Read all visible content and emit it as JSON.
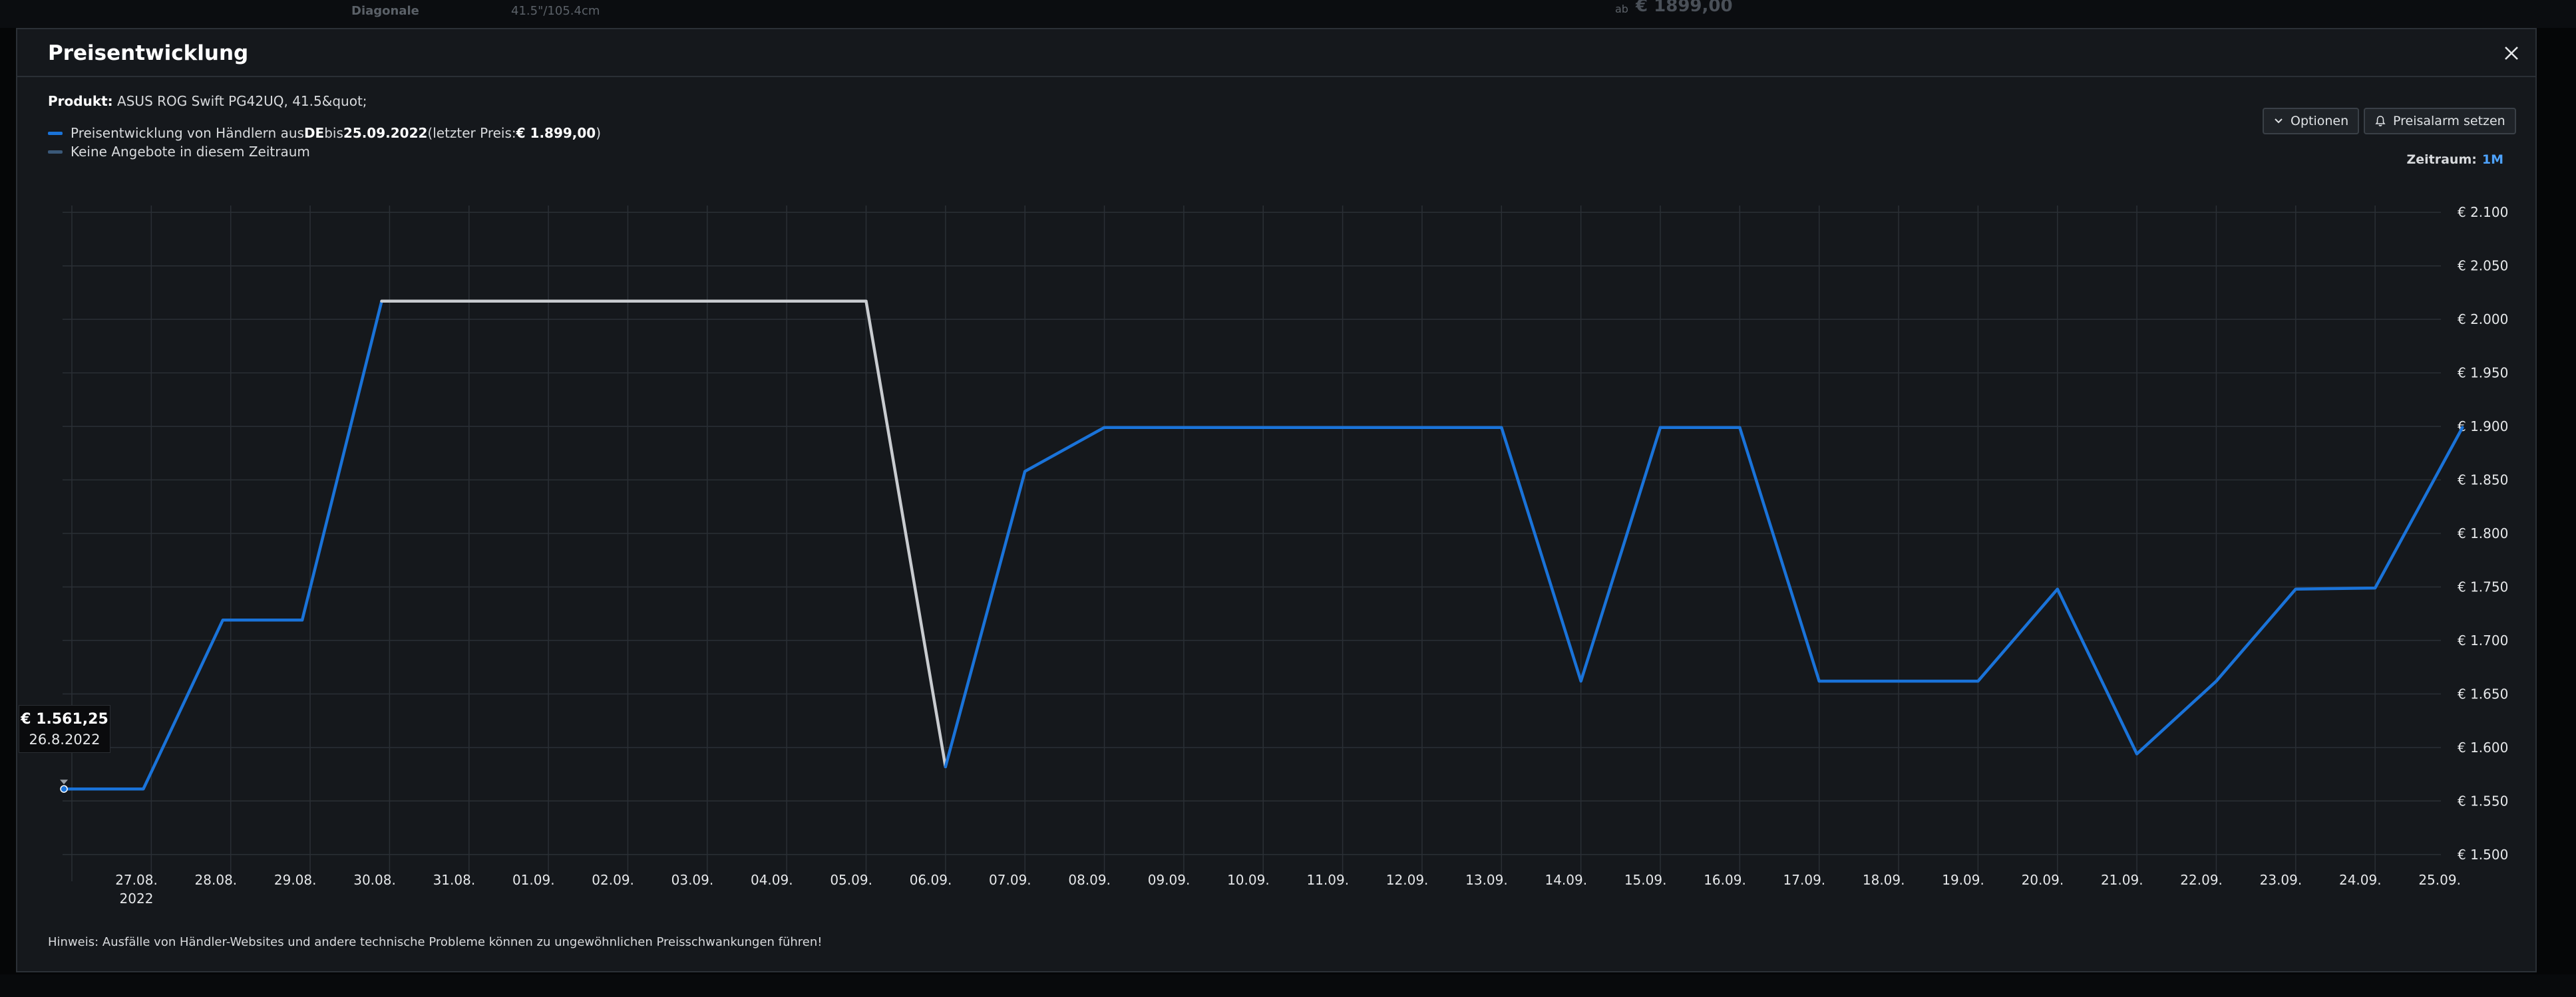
{
  "background": {
    "label": "Diagonale",
    "value": "41.5\"/105.4cm",
    "price": "€ 1899,00",
    "price_prefix": "ab"
  },
  "modal": {
    "title": "Preisentwicklung",
    "close_icon": "close-icon"
  },
  "product": {
    "label": "Produkt:",
    "name": "ASUS ROG Swift PG42UQ, 41.5&quot;"
  },
  "legend": [
    {
      "prefix": "Preisentwicklung von Händlern aus ",
      "country": "DE",
      "mid": " bis ",
      "date": "25.09.2022",
      "suffix_open": " (letzter Preis: ",
      "last_price": "€ 1.899,00",
      "suffix_close": ")",
      "color": "#1a73d9"
    },
    {
      "text": "Keine Angebote in diesem Zeitraum",
      "color": "#3a5878"
    }
  ],
  "buttons": {
    "options_label": "Optionen",
    "options_icon": "chevron-down-icon",
    "alarm_label": "Preisalarm setzen",
    "alarm_icon": "bell-icon"
  },
  "zeitraum": {
    "label": "Zeitraum:",
    "value": "1M"
  },
  "tooltip": {
    "price": "€ 1.561,25",
    "date": "26.8.2022"
  },
  "hint": "Hinweis: Ausfälle von Händler-Websites und andere technische Probleme können zu ungewöhnlichen Preisschwankungen führen!",
  "colors": {
    "price_line": "#1a73d9",
    "no_offer_line": "#c9ccd0",
    "grid": "#2a2f35"
  },
  "chart_data": {
    "type": "line",
    "x_year_label": "2022",
    "x_labels": [
      "27.08.",
      "28.08.",
      "29.08.",
      "30.08.",
      "31.08.",
      "01.09.",
      "02.09.",
      "03.09.",
      "04.09.",
      "05.09.",
      "06.09.",
      "07.09.",
      "08.09.",
      "09.09.",
      "10.09.",
      "11.09.",
      "12.09.",
      "13.09.",
      "14.09.",
      "15.09.",
      "16.09.",
      "17.09.",
      "18.09.",
      "19.09.",
      "20.09.",
      "21.09.",
      "22.09.",
      "23.09.",
      "24.09.",
      "25.09."
    ],
    "y_tick_values": [
      1500,
      1550,
      1600,
      1650,
      1700,
      1750,
      1800,
      1850,
      1900,
      1950,
      2000,
      2050,
      2100
    ],
    "y_tick_labels": [
      "€ 1.500",
      "€ 1.550",
      "€ 1.600",
      "€ 1.650",
      "€ 1.700",
      "€ 1.750",
      "€ 1.800",
      "€ 1.850",
      "€ 1.900",
      "€ 1.950",
      "€ 2.000",
      "€ 2.050",
      "€ 2.100"
    ],
    "ylim": [
      1475,
      2125
    ],
    "x_range_days": [
      -0.1,
      30.1
    ],
    "grid": true,
    "series": [
      {
        "style": "price",
        "points": [
          [
            -0.1,
            1561.25
          ],
          [
            0.9,
            1561.25
          ],
          [
            1.9,
            1719
          ],
          [
            2.9,
            1719
          ],
          [
            3.9,
            2017
          ]
        ]
      },
      {
        "style": "no_offers",
        "points": [
          [
            3.9,
            2017
          ],
          [
            10.0,
            2017
          ],
          [
            11.0,
            1582
          ]
        ]
      },
      {
        "style": "price",
        "points": [
          [
            11.0,
            1582
          ],
          [
            12.0,
            1858
          ],
          [
            13.0,
            1899
          ],
          [
            18.0,
            1899
          ],
          [
            19.0,
            1662
          ],
          [
            20.0,
            1899
          ],
          [
            21.0,
            1899
          ],
          [
            22.0,
            1662
          ],
          [
            24.0,
            1662
          ],
          [
            25.0,
            1748
          ],
          [
            26.0,
            1594
          ],
          [
            27.0,
            1662
          ],
          [
            28.0,
            1748
          ],
          [
            29.0,
            1749
          ],
          [
            30.1,
            1899
          ]
        ]
      }
    ]
  }
}
